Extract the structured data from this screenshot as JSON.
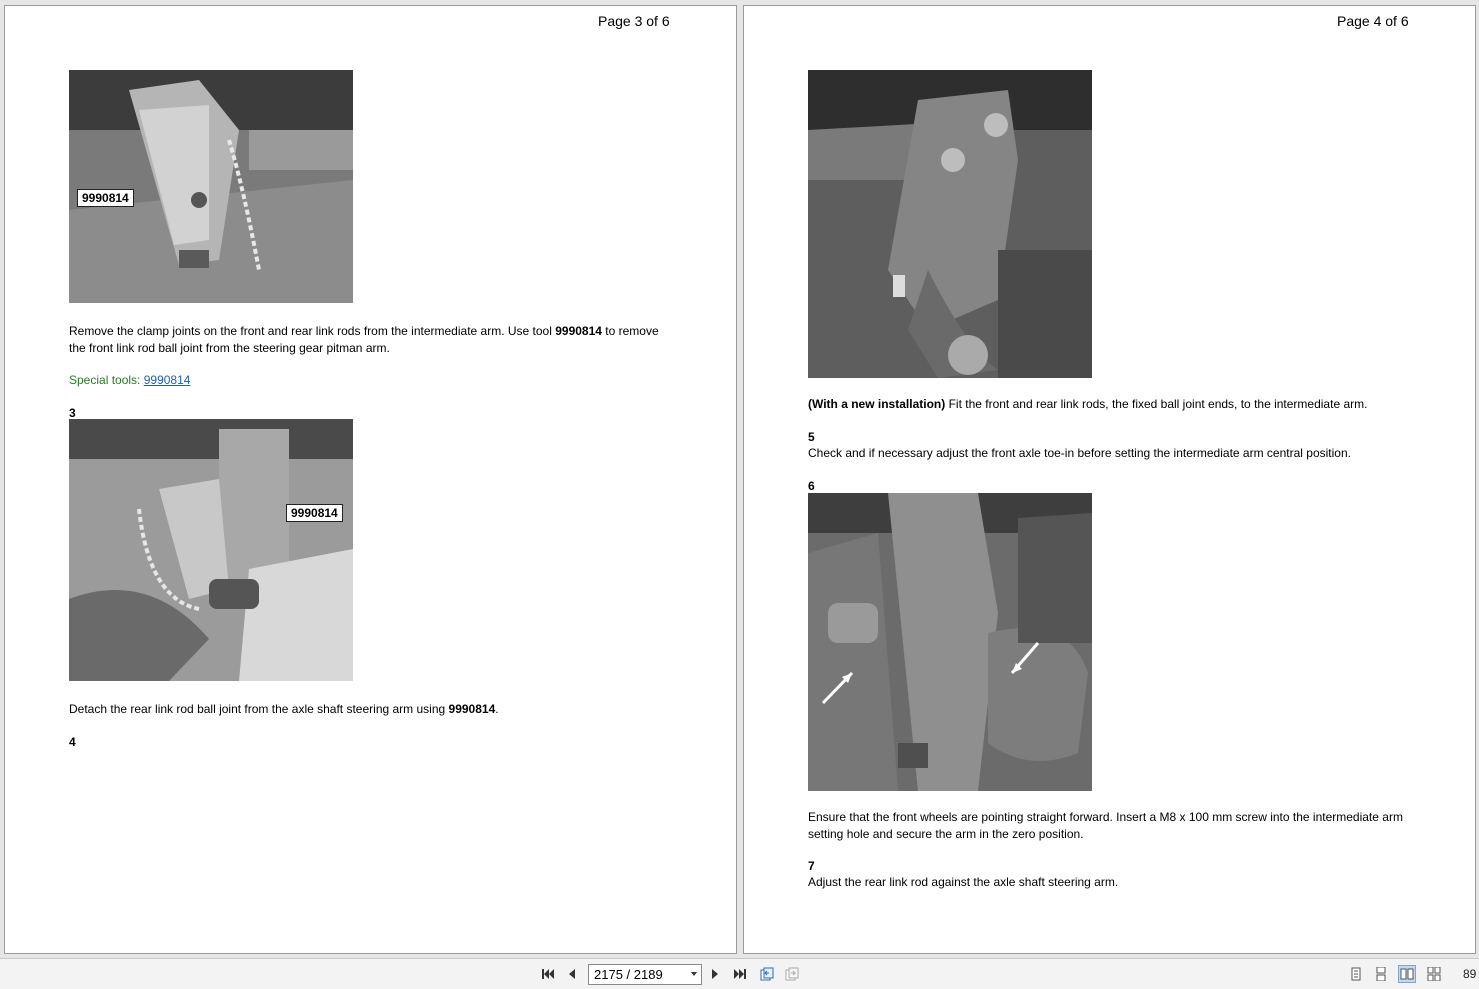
{
  "left_page": {
    "header": "Page 3 of 6",
    "photo1_callout": "9990814",
    "para1_a": "Remove the clamp joints on the front and rear link rods from the intermediate arm. Use tool ",
    "para1_bold": "9990814",
    "para1_b": " to remove",
    "para1_line2": "the front link rod ball joint from the steering gear pitman arm.",
    "special_label": "Special tools: ",
    "special_link": "9990814",
    "step3": "3",
    "photo2_callout": "9990814",
    "para2_a": "Detach the rear link rod ball joint from the axle shaft steering arm using ",
    "para2_bold": "9990814",
    "para2_b": ".",
    "step4": "4"
  },
  "right_page": {
    "header": "Page 4 of 6",
    "para1_bold": "(With a new installation)",
    "para1_rest": " Fit the front and rear link rods, the fixed ball joint ends, to the intermediate arm.",
    "step5": "5",
    "para2": "Check and if necessary adjust the front axle toe-in before setting the intermediate arm central position.",
    "step6": "6",
    "para3_line1": "Ensure that the front wheels are pointing straight forward. Insert a M8 x 100 mm screw into the intermediate arm",
    "para3_line2": "setting hole and secure the arm in the zero position.",
    "step7": "7",
    "para4": "Adjust the rear link rod against the axle shaft steering arm."
  },
  "toolbar": {
    "page_value": "2175 / 2189",
    "zoom": "89",
    "icons": [
      "first-page-icon",
      "prev-page-icon",
      "next-page-icon",
      "last-page-icon",
      "prev-view-icon",
      "next-view-icon",
      "single-page-icon",
      "continuous-icon",
      "two-page-icon",
      "two-page-continuous-icon"
    ]
  }
}
